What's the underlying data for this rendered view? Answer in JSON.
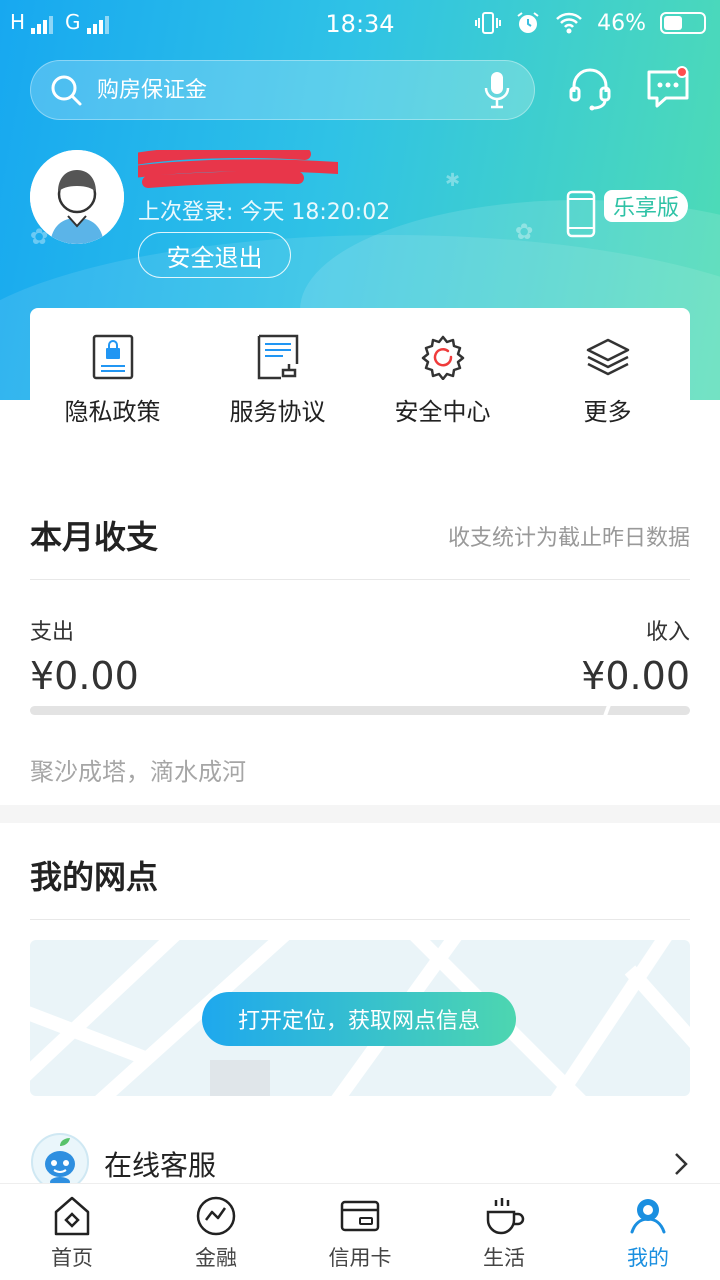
{
  "status_bar": {
    "network_left": "H",
    "network_right": "G",
    "time": "18:34",
    "battery": "46%"
  },
  "search": {
    "placeholder": "购房保证金"
  },
  "profile": {
    "last_login": "上次登录: 今天 18:20:02",
    "logout_label": "安全退出",
    "edition_badge": "乐享版"
  },
  "quick_actions": [
    {
      "label": "隐私政策",
      "icon": "privacy-doc-icon"
    },
    {
      "label": "服务协议",
      "icon": "agreement-doc-icon"
    },
    {
      "label": "安全中心",
      "icon": "security-gear-icon"
    },
    {
      "label": "更多",
      "icon": "layers-icon"
    }
  ],
  "monthly": {
    "title": "本月收支",
    "note": "收支统计为截止昨日数据",
    "expense_label": "支出",
    "expense_value": "¥0.00",
    "income_label": "收入",
    "income_value": "¥0.00",
    "motto": "聚沙成塔，滴水成河"
  },
  "branches": {
    "title": "我的网点",
    "locate_button": "打开定位，获取网点信息"
  },
  "service": {
    "label": "在线客服"
  },
  "nav": {
    "tabs": [
      {
        "label": "首页",
        "icon": "home-icon"
      },
      {
        "label": "金融",
        "icon": "trend-icon"
      },
      {
        "label": "信用卡",
        "icon": "card-icon"
      },
      {
        "label": "生活",
        "icon": "coffee-icon"
      },
      {
        "label": "我的",
        "icon": "user-icon"
      }
    ],
    "active_index": 4
  },
  "colors": {
    "accent": "#1a8fe0",
    "gradient_start": "#17a8f0",
    "gradient_end": "#4fdcb4",
    "notification_dot": "#ff4f4f"
  }
}
